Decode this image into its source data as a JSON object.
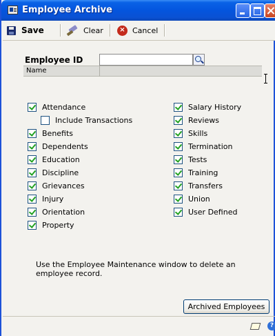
{
  "window": {
    "title": "Employee Archive"
  },
  "toolbar": {
    "save_label": "Save",
    "clear_label": "Clear",
    "cancel_label": "Cancel",
    "cancel_glyph": "×"
  },
  "form": {
    "employee_id_label": "Employee ID",
    "employee_id_value": "",
    "name_label": "Name",
    "name_value": ""
  },
  "options_left": [
    {
      "label": "Attendance",
      "checked": true
    },
    {
      "label": "Include Transactions",
      "checked": false
    },
    {
      "label": "Benefits",
      "checked": true
    },
    {
      "label": "Dependents",
      "checked": true
    },
    {
      "label": "Education",
      "checked": true
    },
    {
      "label": "Discipline",
      "checked": true
    },
    {
      "label": "Grievances",
      "checked": true
    },
    {
      "label": "Injury",
      "checked": true
    },
    {
      "label": "Orientation",
      "checked": true
    },
    {
      "label": "Property",
      "checked": true
    }
  ],
  "options_right": [
    {
      "label": "Salary History",
      "checked": true
    },
    {
      "label": "Reviews",
      "checked": true
    },
    {
      "label": "Skills",
      "checked": true
    },
    {
      "label": "Termination",
      "checked": true
    },
    {
      "label": "Tests",
      "checked": true
    },
    {
      "label": "Training",
      "checked": true
    },
    {
      "label": "Transfers",
      "checked": true
    },
    {
      "label": "Union",
      "checked": true
    },
    {
      "label": "User Defined",
      "checked": true
    }
  ],
  "info_text": "Use the Employee Maintenance window to delete an employee record.",
  "archived_button_label": "Archived Employees",
  "footer": {
    "help_glyph": "?"
  },
  "colors": {
    "titlebar": "#0455de",
    "window_bg": "#f3f2ee",
    "check_green": "#21a121",
    "cancel_red": "#c42b1c"
  }
}
